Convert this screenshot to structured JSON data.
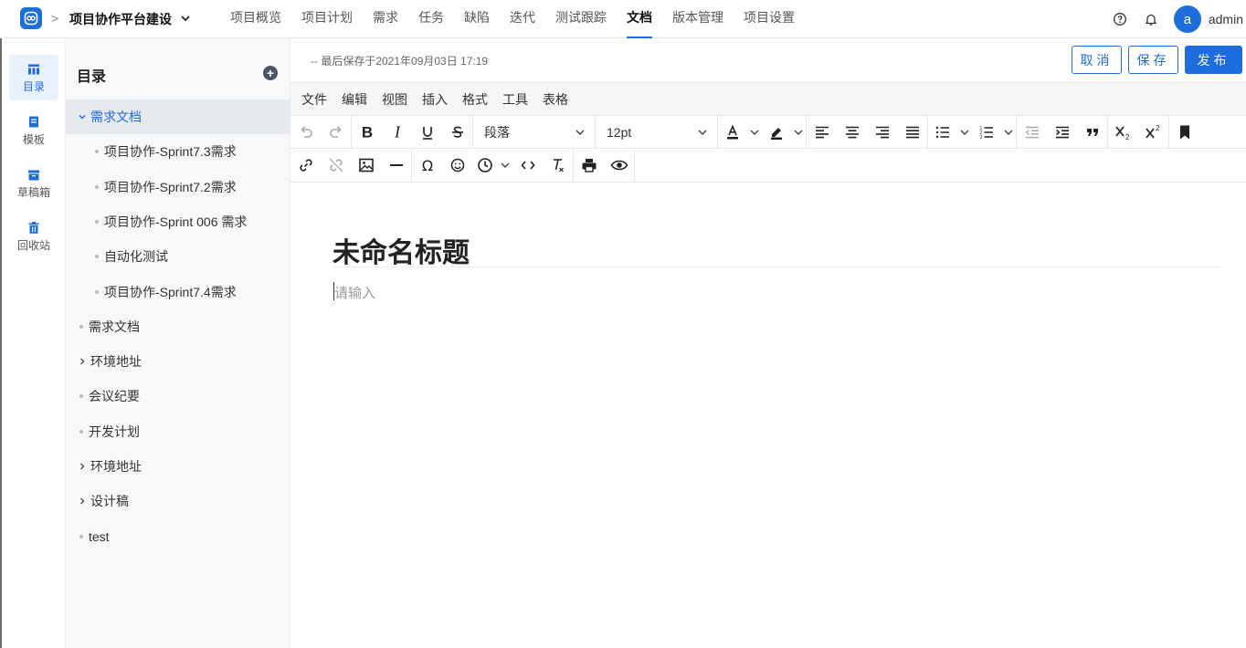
{
  "header": {
    "project_name": "项目协作平台建设",
    "crumb_separator": ">",
    "nav": [
      {
        "label": "项目概览",
        "name": "nav-overview"
      },
      {
        "label": "项目计划",
        "name": "nav-plan"
      },
      {
        "label": "需求",
        "name": "nav-requirements"
      },
      {
        "label": "任务",
        "name": "nav-tasks"
      },
      {
        "label": "缺陷",
        "name": "nav-defects"
      },
      {
        "label": "迭代",
        "name": "nav-iterations"
      },
      {
        "label": "测试跟踪",
        "name": "nav-test-tracking"
      },
      {
        "label": "文档",
        "name": "nav-docs",
        "active": true
      },
      {
        "label": "版本管理",
        "name": "nav-versions"
      },
      {
        "label": "项目设置",
        "name": "nav-settings"
      }
    ],
    "avatar_letter": "a",
    "username": "admin"
  },
  "rail": {
    "items": [
      {
        "label": "目录",
        "icon": "catalog-icon",
        "active": true
      },
      {
        "label": "模板",
        "icon": "template-icon"
      },
      {
        "label": "草稿箱",
        "icon": "drafts-icon"
      },
      {
        "label": "回收站",
        "icon": "trash-icon"
      }
    ]
  },
  "directory": {
    "title": "目录",
    "items": [
      {
        "label": "需求文档",
        "level": 0,
        "mark": "expanded",
        "selected": true
      },
      {
        "label": "项目协作-Sprint7.3需求",
        "level": 1,
        "mark": "dot"
      },
      {
        "label": "项目协作-Sprint7.2需求",
        "level": 1,
        "mark": "dot"
      },
      {
        "label": "项目协作-Sprint 006 需求",
        "level": 1,
        "mark": "dot"
      },
      {
        "label": "自动化测试",
        "level": 1,
        "mark": "dot"
      },
      {
        "label": "项目协作-Sprint7.4需求",
        "level": 1,
        "mark": "dot"
      },
      {
        "label": "需求文档",
        "level": 0,
        "mark": "dot"
      },
      {
        "label": "环境地址",
        "level": 0,
        "mark": "collapsed"
      },
      {
        "label": "会议纪要",
        "level": 0,
        "mark": "dot"
      },
      {
        "label": "开发计划",
        "level": 0,
        "mark": "dot"
      },
      {
        "label": "环境地址",
        "level": 0,
        "mark": "collapsed"
      },
      {
        "label": "设计稿",
        "level": 0,
        "mark": "collapsed"
      },
      {
        "label": "test",
        "level": 0,
        "mark": "dot"
      }
    ]
  },
  "editor": {
    "save_status": "-- 最后保存于2021年09月03日 17:19",
    "cancel_label": "取消",
    "save_label": "保存",
    "publish_label": "发布",
    "menus": [
      "文件",
      "编辑",
      "视图",
      "插入",
      "格式",
      "工具",
      "表格"
    ],
    "block_format": "段落",
    "font_size": "12pt",
    "title": "未命名标题",
    "body_placeholder": "请输入"
  },
  "colors": {
    "accent": "#1e6ddc",
    "sidebar_bg": "#f7f8fa",
    "selected_bg": "#e6e9ee"
  }
}
